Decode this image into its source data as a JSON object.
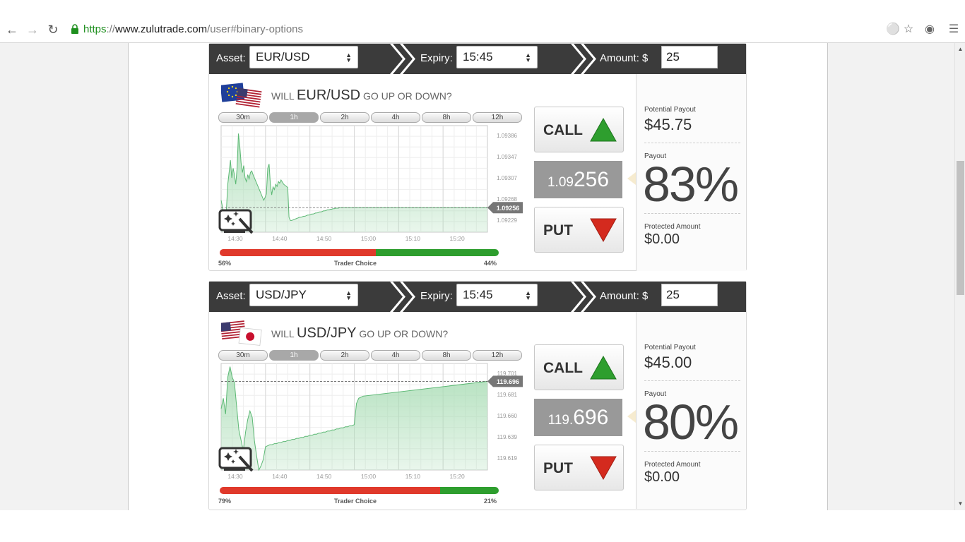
{
  "browser": {
    "url_scheme": "https",
    "url_sep": "://",
    "url_host": "www.zulutrade.com",
    "url_path": "/user#binary-options",
    "icons": [
      "back-icon",
      "forward-icon",
      "reload-icon",
      "lock-icon",
      "key-icon",
      "star-icon",
      "extension-icon",
      "menu-icon"
    ]
  },
  "colors": {
    "topbar": "#3b3b3b",
    "call_green": "#2e9e2e",
    "put_red": "#d42a1e",
    "sentiment_red": "#e0392b",
    "chart_fill": "#a8dcb4"
  },
  "panels": [
    {
      "asset_label": "Asset:",
      "asset_value": "EUR/USD",
      "expiry_label": "Expiry:",
      "expiry_value": "15:45",
      "amount_label": "Amount: $",
      "amount_value": "25",
      "question_prefix": "WILL",
      "question_pair": "EUR/USD",
      "question_suffix": "GO UP OR DOWN?",
      "ranges": [
        "30m",
        "1h",
        "2h",
        "4h",
        "8h",
        "12h"
      ],
      "active_range": "1h",
      "call_label": "CALL",
      "put_label": "PUT",
      "price_small": "1.09",
      "price_big": "256",
      "potential_payout_label": "Potential Payout",
      "potential_payout_value": "$45.75",
      "payout_label": "Payout",
      "payout_value": "83%",
      "protected_label": "Protected Amount",
      "protected_value": "$0.00",
      "sentiment_put_pct": "56%",
      "sentiment_label": "Trader Choice",
      "sentiment_call_pct": "44%",
      "sentiment_put_fraction": 0.56,
      "chart_data": {
        "type": "area",
        "x_ticks": [
          "14:30",
          "14:40",
          "14:50",
          "15:00",
          "15:10",
          "15:20"
        ],
        "y_ticks": [
          "1.09386",
          "1.09347",
          "1.09307",
          "1.09268",
          "1.09229"
        ],
        "y_range": [
          1.0921,
          1.0941
        ],
        "current_label": "1.09256",
        "current": 1.09256,
        "x": [
          0,
          0.03,
          0.06,
          0.09,
          0.12,
          0.15,
          0.18,
          0.21,
          0.24,
          0.27,
          0.3,
          0.33,
          0.36,
          0.39,
          0.42,
          0.45,
          0.48,
          0.51,
          0.54,
          0.57,
          0.6,
          0.63,
          0.66,
          0.69,
          0.72,
          0.75,
          0.78,
          0.81,
          0.84,
          0.87,
          0.9,
          0.93,
          0.96,
          0.99,
          1.02,
          1.05,
          1.08,
          1.11,
          1.14,
          1.17,
          1.2,
          1.23,
          1.26,
          1.29,
          1.32,
          1.35,
          1.38,
          1.41,
          1.44,
          1.47,
          1.5,
          1.53,
          1.56,
          1.59,
          1.62,
          1.65,
          1.68,
          1.71,
          1.74,
          1.77,
          1.8,
          1.83,
          1.86,
          1.89,
          1.92,
          1.95,
          1.98,
          2.01,
          2.04,
          2.07,
          2.1,
          2.13,
          2.16,
          2.19,
          2.22,
          2.25,
          2.28,
          2.31,
          2.34,
          2.37,
          2.4,
          2.43,
          2.46,
          2.49,
          2.52,
          2.55,
          2.58,
          2.61,
          2.64,
          2.67,
          2.7,
          2.73,
          2.76,
          2.79,
          2.82,
          2.85,
          2.88,
          2.91,
          2.94,
          2.97,
          3.0,
          6.0
        ],
        "y": [
          1.0927,
          1.09258,
          1.0924,
          1.09245,
          1.09252,
          1.093,
          1.09322,
          1.09345,
          1.09312,
          1.0933,
          1.09318,
          1.093,
          1.0933,
          1.09395,
          1.09372,
          1.0934,
          1.09322,
          1.09335,
          1.09312,
          1.09305,
          1.09318,
          1.0931,
          1.09322,
          1.09325,
          1.09318,
          1.09312,
          1.09306,
          1.093,
          1.09294,
          1.09288,
          1.09282,
          1.09276,
          1.0927,
          1.09275,
          1.09282,
          1.0933,
          1.09338,
          1.093,
          1.0928,
          1.09295,
          1.0929,
          1.093,
          1.09296,
          1.09305,
          1.09302,
          1.09308,
          1.09304,
          1.093,
          1.09298,
          1.09296,
          1.09294,
          1.09238,
          1.09232,
          1.09232,
          1.09233,
          1.09234,
          1.09235,
          1.09236,
          1.09237,
          1.09238,
          1.09238,
          1.09239,
          1.0924,
          1.0924,
          1.09241,
          1.09242,
          1.09242,
          1.09243,
          1.09244,
          1.09244,
          1.09245,
          1.09246,
          1.09246,
          1.09247,
          1.09248,
          1.09248,
          1.09249,
          1.0925,
          1.0925,
          1.09251,
          1.09252,
          1.09252,
          1.09253,
          1.09253,
          1.09254,
          1.09254,
          1.09255,
          1.09255,
          1.09255,
          1.09256,
          1.09256,
          1.09256,
          1.09256,
          1.09256,
          1.09256,
          1.09256,
          1.09256,
          1.09256,
          1.09256,
          1.09256,
          1.09256,
          1.09256
        ]
      }
    },
    {
      "asset_label": "Asset:",
      "asset_value": "USD/JPY",
      "expiry_label": "Expiry:",
      "expiry_value": "15:45",
      "amount_label": "Amount: $",
      "amount_value": "25",
      "question_prefix": "WILL",
      "question_pair": "USD/JPY",
      "question_suffix": "GO UP OR DOWN?",
      "ranges": [
        "30m",
        "1h",
        "2h",
        "4h",
        "8h",
        "12h"
      ],
      "active_range": "1h",
      "call_label": "CALL",
      "put_label": "PUT",
      "price_small": "119.",
      "price_big": "696",
      "potential_payout_label": "Potential Payout",
      "potential_payout_value": "$45.00",
      "payout_label": "Payout",
      "payout_value": "80%",
      "protected_label": "Protected Amount",
      "protected_value": "$0.00",
      "sentiment_put_pct": "79%",
      "sentiment_label": "Trader Choice",
      "sentiment_call_pct": "21%",
      "sentiment_put_fraction": 0.79,
      "chart_data": {
        "type": "area",
        "x_ticks": [
          "14:30",
          "14:40",
          "14:50",
          "15:00",
          "15:10",
          "15:20"
        ],
        "y_ticks": [
          "119.701",
          "119.681",
          "119.660",
          "119.639",
          "119.619"
        ],
        "y_range": [
          119.612,
          119.713
        ],
        "current_label": "119.696",
        "current": 119.696,
        "x": [
          0,
          0.05,
          0.1,
          0.15,
          0.2,
          0.25,
          0.3,
          0.35,
          0.4,
          0.45,
          0.5,
          0.55,
          0.6,
          0.65,
          0.7,
          0.75,
          0.8,
          0.85,
          0.9,
          0.95,
          1.0,
          1.05,
          1.1,
          1.15,
          1.2,
          1.25,
          1.3,
          1.35,
          1.4,
          1.45,
          1.5,
          1.55,
          1.6,
          1.65,
          1.7,
          1.75,
          1.8,
          1.85,
          1.9,
          1.95,
          2.0,
          2.05,
          2.1,
          2.15,
          2.2,
          2.25,
          2.3,
          2.35,
          2.4,
          2.45,
          2.5,
          2.55,
          2.6,
          2.65,
          2.7,
          2.75,
          2.8,
          2.85,
          2.9,
          2.95,
          3.0,
          3.05,
          3.1,
          3.15,
          3.2,
          6.0
        ],
        "y": [
          119.67,
          119.68,
          119.665,
          119.7,
          119.71,
          119.7,
          119.695,
          119.672,
          119.65,
          119.64,
          119.63,
          119.648,
          119.66,
          119.668,
          119.662,
          119.64,
          119.625,
          119.612,
          119.616,
          119.622,
          119.634,
          119.635,
          119.636,
          119.636,
          119.637,
          119.637,
          119.638,
          119.638,
          119.639,
          119.639,
          119.64,
          119.64,
          119.641,
          119.641,
          119.642,
          119.642,
          119.643,
          119.643,
          119.644,
          119.644,
          119.645,
          119.645,
          119.646,
          119.646,
          119.647,
          119.647,
          119.648,
          119.648,
          119.649,
          119.649,
          119.65,
          119.65,
          119.651,
          119.651,
          119.652,
          119.652,
          119.653,
          119.653,
          119.654,
          119.654,
          119.655,
          119.675,
          119.68,
          119.681,
          119.682,
          119.696
        ]
      }
    }
  ]
}
